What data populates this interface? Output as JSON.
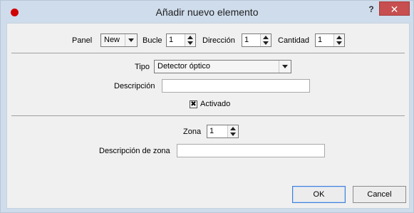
{
  "window": {
    "title": "Añadir nuevo elemento",
    "help_label": "?",
    "close_label": "✕"
  },
  "top_row": {
    "panel_label": "Panel",
    "panel_value": "New",
    "bucle_label": "Bucle",
    "bucle_value": "1",
    "direccion_label": "Dirección",
    "direccion_value": "1",
    "cantidad_label": "Cantidad",
    "cantidad_value": "1"
  },
  "details": {
    "tipo_label": "Tipo",
    "tipo_value": "Detector óptico",
    "descripcion_label": "Descripción",
    "descripcion_value": "",
    "activado_label": "Activado",
    "activado_checked": true,
    "activado_mark": "✖"
  },
  "zone": {
    "zona_label": "Zona",
    "zona_value": "1",
    "descripcion_zona_label": "Descripción de zona",
    "descripcion_zona_value": ""
  },
  "buttons": {
    "ok_label": "OK",
    "cancel_label": "Cancel"
  }
}
